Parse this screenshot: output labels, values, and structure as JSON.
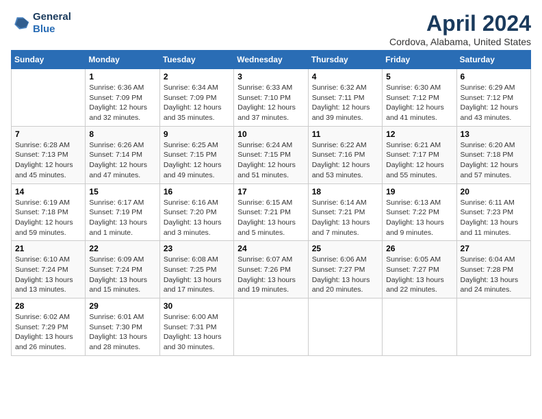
{
  "header": {
    "logo_line1": "General",
    "logo_line2": "Blue",
    "month_title": "April 2024",
    "location": "Cordova, Alabama, United States"
  },
  "days_of_week": [
    "Sunday",
    "Monday",
    "Tuesday",
    "Wednesday",
    "Thursday",
    "Friday",
    "Saturday"
  ],
  "weeks": [
    [
      {
        "num": "",
        "info": ""
      },
      {
        "num": "1",
        "info": "Sunrise: 6:36 AM\nSunset: 7:09 PM\nDaylight: 12 hours\nand 32 minutes."
      },
      {
        "num": "2",
        "info": "Sunrise: 6:34 AM\nSunset: 7:09 PM\nDaylight: 12 hours\nand 35 minutes."
      },
      {
        "num": "3",
        "info": "Sunrise: 6:33 AM\nSunset: 7:10 PM\nDaylight: 12 hours\nand 37 minutes."
      },
      {
        "num": "4",
        "info": "Sunrise: 6:32 AM\nSunset: 7:11 PM\nDaylight: 12 hours\nand 39 minutes."
      },
      {
        "num": "5",
        "info": "Sunrise: 6:30 AM\nSunset: 7:12 PM\nDaylight: 12 hours\nand 41 minutes."
      },
      {
        "num": "6",
        "info": "Sunrise: 6:29 AM\nSunset: 7:12 PM\nDaylight: 12 hours\nand 43 minutes."
      }
    ],
    [
      {
        "num": "7",
        "info": "Sunrise: 6:28 AM\nSunset: 7:13 PM\nDaylight: 12 hours\nand 45 minutes."
      },
      {
        "num": "8",
        "info": "Sunrise: 6:26 AM\nSunset: 7:14 PM\nDaylight: 12 hours\nand 47 minutes."
      },
      {
        "num": "9",
        "info": "Sunrise: 6:25 AM\nSunset: 7:15 PM\nDaylight: 12 hours\nand 49 minutes."
      },
      {
        "num": "10",
        "info": "Sunrise: 6:24 AM\nSunset: 7:15 PM\nDaylight: 12 hours\nand 51 minutes."
      },
      {
        "num": "11",
        "info": "Sunrise: 6:22 AM\nSunset: 7:16 PM\nDaylight: 12 hours\nand 53 minutes."
      },
      {
        "num": "12",
        "info": "Sunrise: 6:21 AM\nSunset: 7:17 PM\nDaylight: 12 hours\nand 55 minutes."
      },
      {
        "num": "13",
        "info": "Sunrise: 6:20 AM\nSunset: 7:18 PM\nDaylight: 12 hours\nand 57 minutes."
      }
    ],
    [
      {
        "num": "14",
        "info": "Sunrise: 6:19 AM\nSunset: 7:18 PM\nDaylight: 12 hours\nand 59 minutes."
      },
      {
        "num": "15",
        "info": "Sunrise: 6:17 AM\nSunset: 7:19 PM\nDaylight: 13 hours\nand 1 minute."
      },
      {
        "num": "16",
        "info": "Sunrise: 6:16 AM\nSunset: 7:20 PM\nDaylight: 13 hours\nand 3 minutes."
      },
      {
        "num": "17",
        "info": "Sunrise: 6:15 AM\nSunset: 7:21 PM\nDaylight: 13 hours\nand 5 minutes."
      },
      {
        "num": "18",
        "info": "Sunrise: 6:14 AM\nSunset: 7:21 PM\nDaylight: 13 hours\nand 7 minutes."
      },
      {
        "num": "19",
        "info": "Sunrise: 6:13 AM\nSunset: 7:22 PM\nDaylight: 13 hours\nand 9 minutes."
      },
      {
        "num": "20",
        "info": "Sunrise: 6:11 AM\nSunset: 7:23 PM\nDaylight: 13 hours\nand 11 minutes."
      }
    ],
    [
      {
        "num": "21",
        "info": "Sunrise: 6:10 AM\nSunset: 7:24 PM\nDaylight: 13 hours\nand 13 minutes."
      },
      {
        "num": "22",
        "info": "Sunrise: 6:09 AM\nSunset: 7:24 PM\nDaylight: 13 hours\nand 15 minutes."
      },
      {
        "num": "23",
        "info": "Sunrise: 6:08 AM\nSunset: 7:25 PM\nDaylight: 13 hours\nand 17 minutes."
      },
      {
        "num": "24",
        "info": "Sunrise: 6:07 AM\nSunset: 7:26 PM\nDaylight: 13 hours\nand 19 minutes."
      },
      {
        "num": "25",
        "info": "Sunrise: 6:06 AM\nSunset: 7:27 PM\nDaylight: 13 hours\nand 20 minutes."
      },
      {
        "num": "26",
        "info": "Sunrise: 6:05 AM\nSunset: 7:27 PM\nDaylight: 13 hours\nand 22 minutes."
      },
      {
        "num": "27",
        "info": "Sunrise: 6:04 AM\nSunset: 7:28 PM\nDaylight: 13 hours\nand 24 minutes."
      }
    ],
    [
      {
        "num": "28",
        "info": "Sunrise: 6:02 AM\nSunset: 7:29 PM\nDaylight: 13 hours\nand 26 minutes."
      },
      {
        "num": "29",
        "info": "Sunrise: 6:01 AM\nSunset: 7:30 PM\nDaylight: 13 hours\nand 28 minutes."
      },
      {
        "num": "30",
        "info": "Sunrise: 6:00 AM\nSunset: 7:31 PM\nDaylight: 13 hours\nand 30 minutes."
      },
      {
        "num": "",
        "info": ""
      },
      {
        "num": "",
        "info": ""
      },
      {
        "num": "",
        "info": ""
      },
      {
        "num": "",
        "info": ""
      }
    ]
  ]
}
